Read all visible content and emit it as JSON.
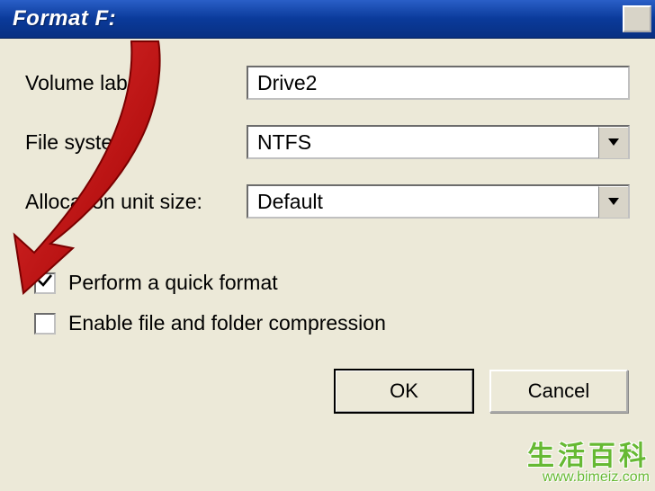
{
  "window": {
    "title": "Format F:"
  },
  "fields": {
    "volume_label": {
      "label": "Volume label:",
      "value": "Drive2"
    },
    "file_system": {
      "label": "File system:",
      "value": "NTFS"
    },
    "allocation": {
      "label": "Allocation unit size:",
      "value": "Default"
    }
  },
  "checkboxes": {
    "quick_format": {
      "label": "Perform a quick format",
      "checked": true
    },
    "compression": {
      "label": "Enable file and folder compression",
      "checked": false
    }
  },
  "buttons": {
    "ok": "OK",
    "cancel": "Cancel"
  },
  "watermark": {
    "text": "生活百科",
    "url": "www.bimeiz.com"
  },
  "colors": {
    "arrow": "#c40808"
  }
}
